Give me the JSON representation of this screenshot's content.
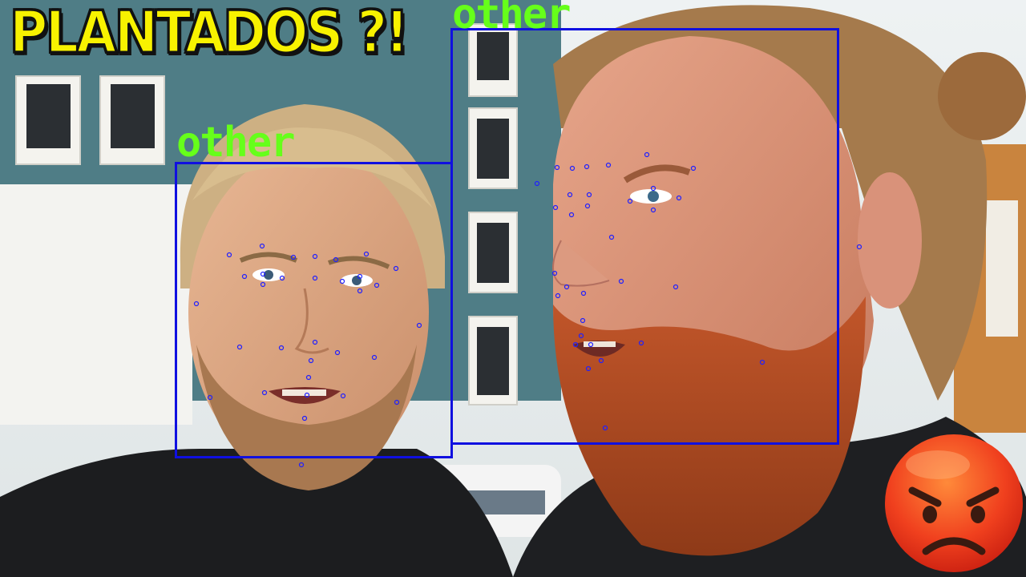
{
  "thumbnail": {
    "title": "PLANTADOS ?!",
    "colors": {
      "title_fill": "#f8f200",
      "title_outline": "#111111",
      "box_stroke": "#1010e0",
      "label_color": "#66ff1a",
      "landmark_color": "#2020ff"
    },
    "emoji_icon": "angry-face-icon"
  },
  "detections": [
    {
      "label": "other"
    },
    {
      "label": "other"
    }
  ]
}
